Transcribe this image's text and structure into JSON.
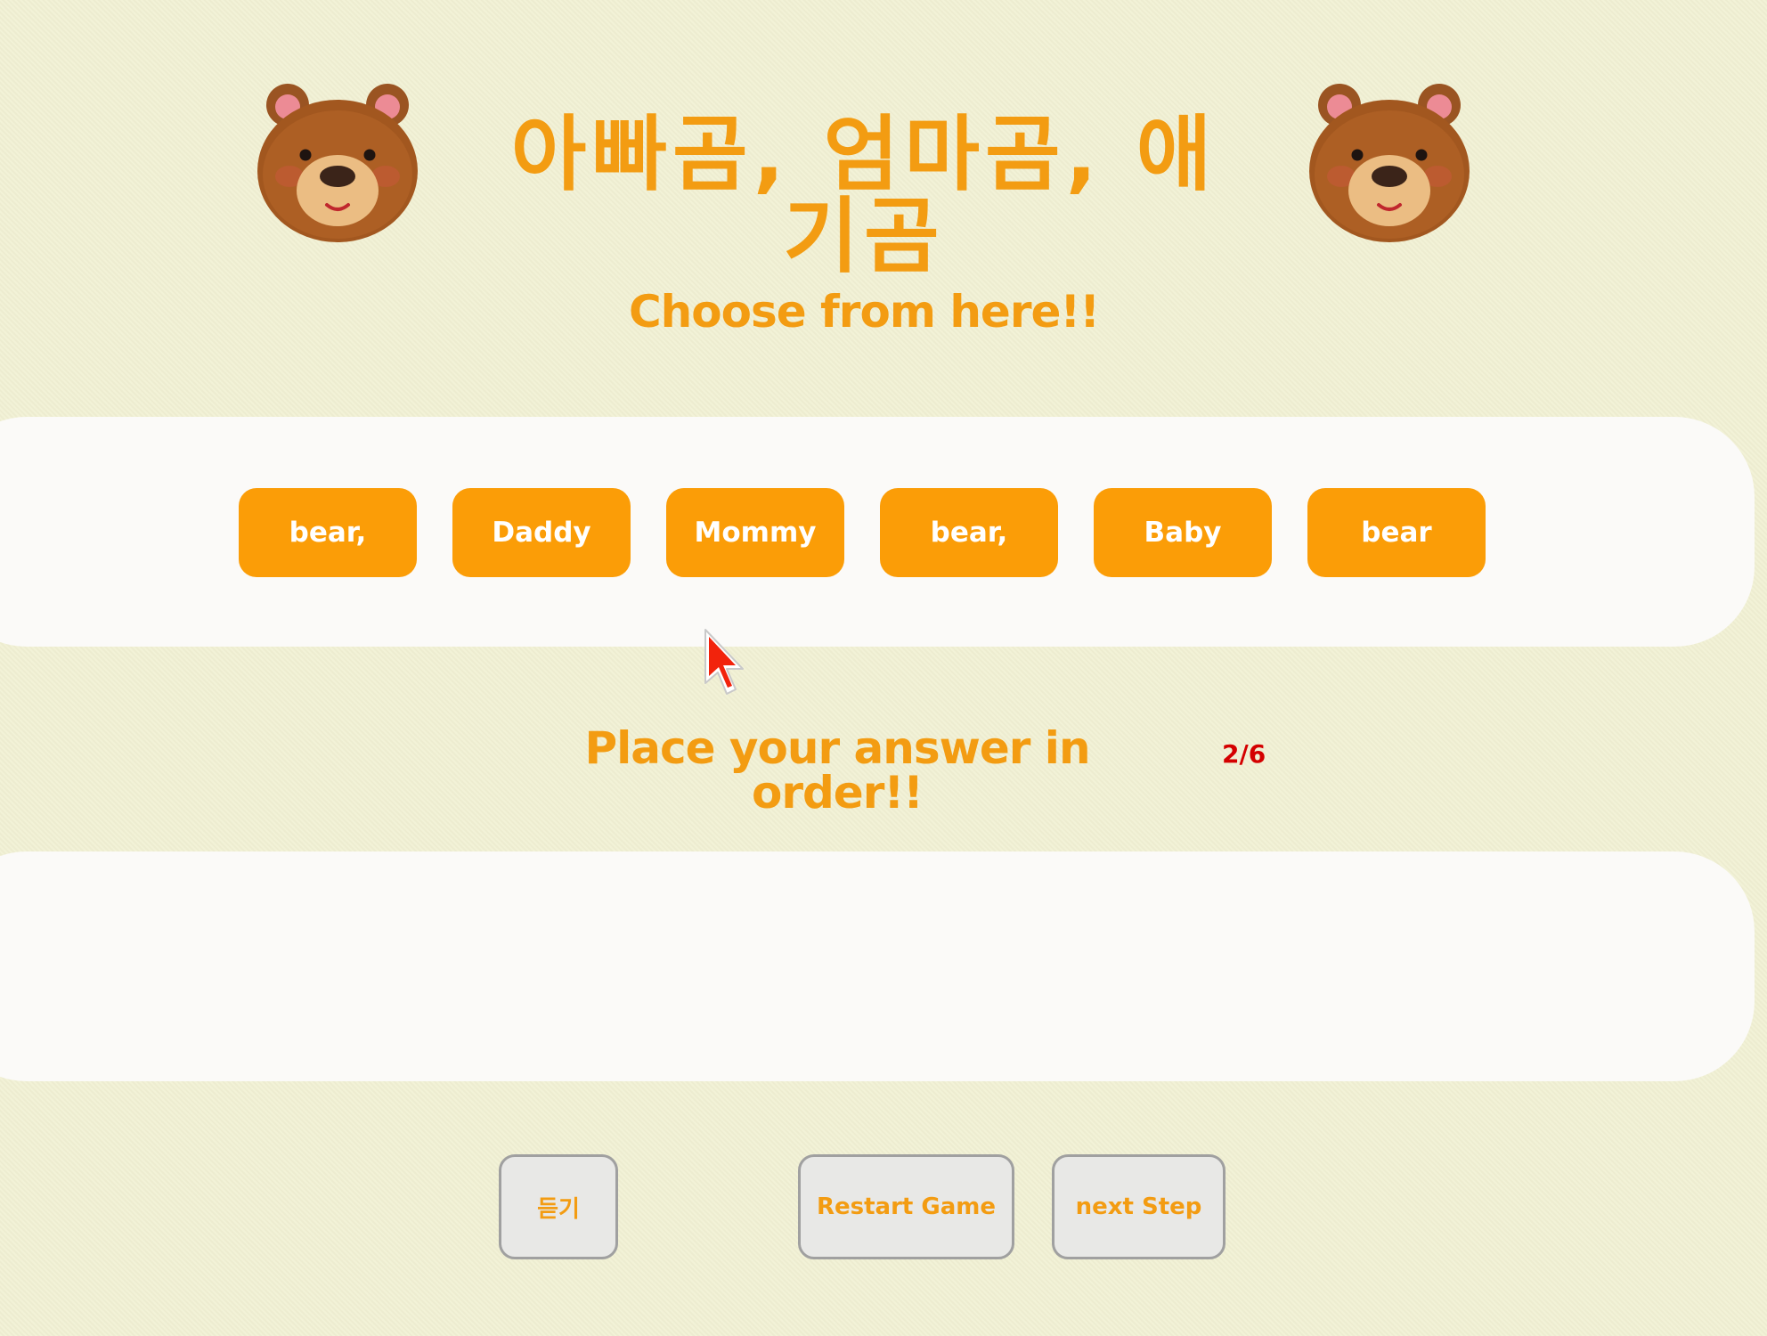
{
  "title": "아빠곰, 엄마곰, 애기곰",
  "choose_heading": "Choose from here!!",
  "answer_heading": "Place your answer in order!!",
  "progress": "2/6",
  "words": [
    "bear,",
    "Daddy",
    "Mommy",
    "bear,",
    "Baby",
    "bear"
  ],
  "answer_words": [],
  "controls": {
    "listen": "듣기",
    "restart": "Restart Game",
    "next": "next Step"
  },
  "icons": {
    "bear": "bear-face-icon",
    "cursor": "mouse-pointer-icon"
  },
  "colors": {
    "background": "#f1f0d3",
    "accent": "#f39c12",
    "word_button": "#fb9d07",
    "progress": "#d40000",
    "panel": "#fbfaf8"
  }
}
